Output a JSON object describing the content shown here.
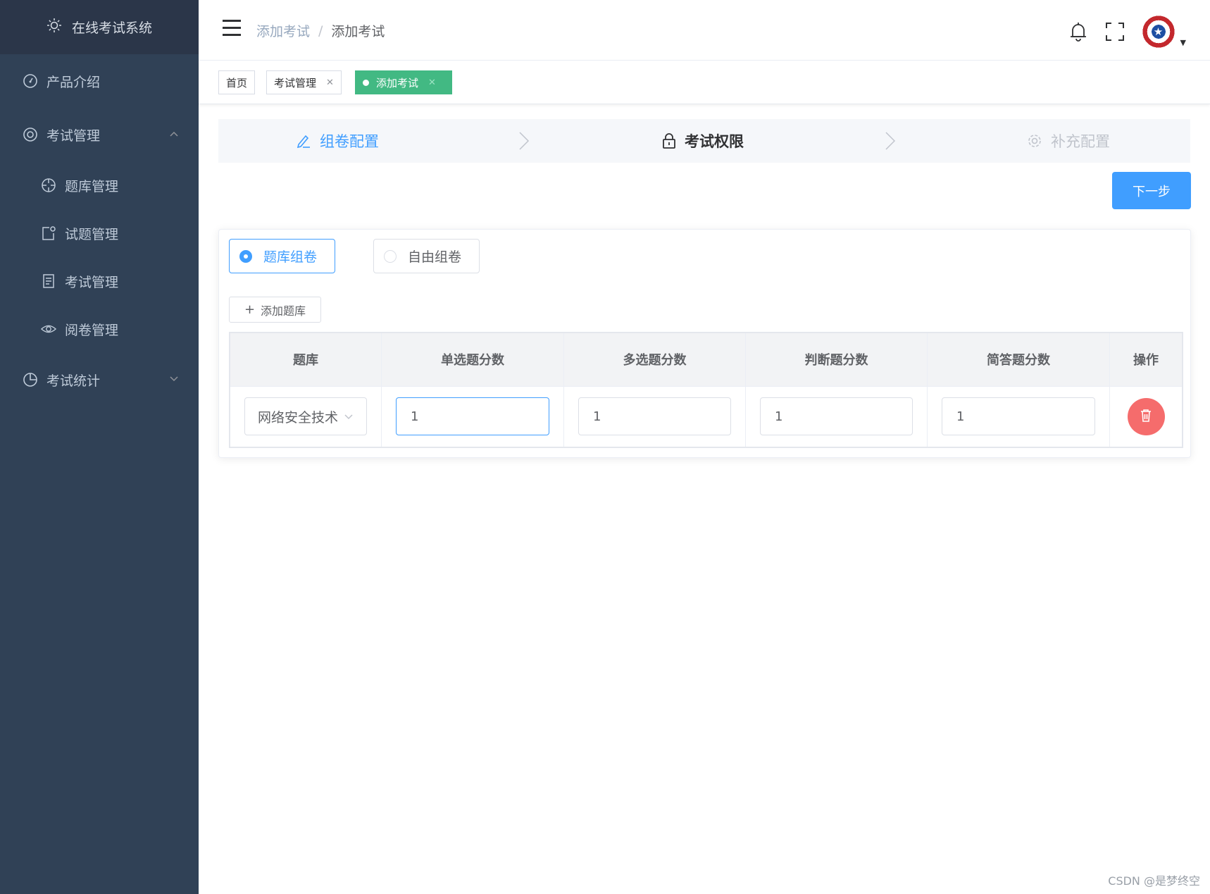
{
  "app": {
    "title": "在线考试系统"
  },
  "sidebar": {
    "items": [
      {
        "label": "产品介绍"
      },
      {
        "label": "考试管理",
        "expanded": true,
        "children": [
          {
            "label": "题库管理"
          },
          {
            "label": "试题管理"
          },
          {
            "label": "考试管理"
          },
          {
            "label": "阅卷管理"
          }
        ]
      },
      {
        "label": "考试统计",
        "expanded": false
      }
    ]
  },
  "header": {
    "breadcrumb": [
      "添加考试",
      "添加考试"
    ],
    "breadcrumb_separator": "/"
  },
  "tags": [
    {
      "label": "首页",
      "closable": false,
      "active": false
    },
    {
      "label": "考试管理",
      "closable": true,
      "active": false
    },
    {
      "label": "添加考试",
      "closable": true,
      "active": true
    }
  ],
  "steps": [
    {
      "label": "组卷配置",
      "status": "done",
      "icon": "edit-icon"
    },
    {
      "label": "考试权限",
      "status": "current",
      "icon": "lock-icon"
    },
    {
      "label": "补充配置",
      "status": "wait",
      "icon": "gear-icon"
    }
  ],
  "next_button": {
    "label": "下一步"
  },
  "paper_mode": {
    "options": [
      {
        "label": "题库组卷",
        "checked": true
      },
      {
        "label": "自由组卷",
        "checked": false
      }
    ]
  },
  "add_bank_button": {
    "label": "添加题库",
    "icon": "plus-icon"
  },
  "table": {
    "columns": [
      "题库",
      "单选题分数",
      "多选题分数",
      "判断题分数",
      "简答题分数",
      "操作"
    ],
    "rows": [
      {
        "bank": "网络安全技术",
        "single": "1",
        "multi": "1",
        "judge": "1",
        "short": "1"
      }
    ]
  },
  "watermark": "CSDN @是梦终空",
  "colors": {
    "sidebar_bg": "#304156",
    "primary": "#409eff",
    "tag_active": "#42b983",
    "danger": "#f56c6c"
  }
}
